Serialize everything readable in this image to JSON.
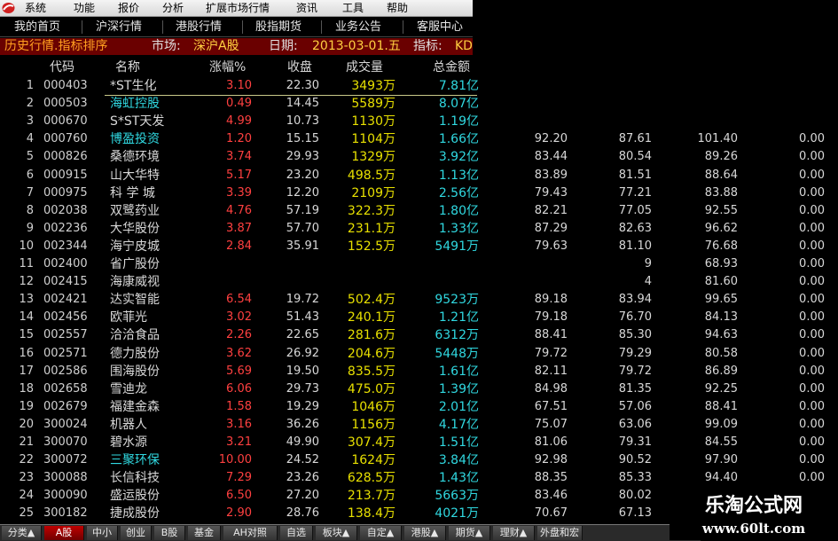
{
  "menu": [
    "系统",
    "功能",
    "报价",
    "分析",
    "扩展市场行情",
    "资讯",
    "工具",
    "帮助"
  ],
  "nav": [
    "我的首页",
    "沪深行情",
    "港股行情",
    "股指期货",
    "业务公告",
    "客服中心"
  ],
  "info": {
    "title": "历史行情.指标排序",
    "market_label": "市场:",
    "market_value": "深沪A股",
    "date_label": "日期:",
    "date_value": "2013-03-01.五",
    "indicator_label": "指标:",
    "indicator_value": "KD"
  },
  "columns": {
    "code": "代码",
    "name": "名称",
    "pct": "涨幅%",
    "close": "收盘",
    "volume": "成交量",
    "amount": "总金额"
  },
  "rows": [
    {
      "idx": "1",
      "code": "000403",
      "name": "*ST生化",
      "pct": "3.10",
      "close": "22.30",
      "vol": "3493万",
      "amt": "7.81亿",
      "e1": "",
      "e2": "",
      "e3": "",
      "e4": "",
      "cyan": false
    },
    {
      "idx": "2",
      "code": "000503",
      "name": "海虹控股",
      "pct": "0.49",
      "close": "14.45",
      "vol": "5589万",
      "amt": "8.07亿",
      "e1": "",
      "e2": "",
      "e3": "",
      "e4": "",
      "cyan": true
    },
    {
      "idx": "3",
      "code": "000670",
      "name": "S*ST天发",
      "pct": "4.99",
      "close": "10.73",
      "vol": "1130万",
      "amt": "1.19亿",
      "e1": "",
      "e2": "",
      "e3": "",
      "e4": "",
      "cyan": false
    },
    {
      "idx": "4",
      "code": "000760",
      "name": "博盈投资",
      "pct": "1.20",
      "close": "15.15",
      "vol": "1104万",
      "amt": "1.66亿",
      "e1": "92.20",
      "e2": "87.61",
      "e3": "101.40",
      "e4": "0.00",
      "cyan": true
    },
    {
      "idx": "5",
      "code": "000826",
      "name": "桑德环境",
      "pct": "3.74",
      "close": "29.93",
      "vol": "1329万",
      "amt": "3.92亿",
      "e1": "83.44",
      "e2": "80.54",
      "e3": "89.26",
      "e4": "0.00",
      "cyan": false
    },
    {
      "idx": "6",
      "code": "000915",
      "name": "山大华特",
      "pct": "5.17",
      "close": "23.20",
      "vol": "498.5万",
      "amt": "1.13亿",
      "e1": "83.89",
      "e2": "81.51",
      "e3": "88.64",
      "e4": "0.00",
      "cyan": false
    },
    {
      "idx": "7",
      "code": "000975",
      "name": "科 学 城",
      "pct": "3.39",
      "close": "12.20",
      "vol": "2109万",
      "amt": "2.56亿",
      "e1": "79.43",
      "e2": "77.21",
      "e3": "83.88",
      "e4": "0.00",
      "cyan": false
    },
    {
      "idx": "8",
      "code": "002038",
      "name": "双鹭药业",
      "pct": "4.76",
      "close": "57.19",
      "vol": "322.3万",
      "amt": "1.80亿",
      "e1": "82.21",
      "e2": "77.05",
      "e3": "92.55",
      "e4": "0.00",
      "cyan": false
    },
    {
      "idx": "9",
      "code": "002236",
      "name": "大华股份",
      "pct": "3.87",
      "close": "57.70",
      "vol": "231.1万",
      "amt": "1.33亿",
      "e1": "87.29",
      "e2": "82.63",
      "e3": "96.62",
      "e4": "0.00",
      "cyan": false
    },
    {
      "idx": "10",
      "code": "002344",
      "name": "海宁皮城",
      "pct": "2.84",
      "close": "35.91",
      "vol": "152.5万",
      "amt": "5491万",
      "e1": "79.63",
      "e2": "81.10",
      "e3": "76.68",
      "e4": "0.00",
      "cyan": false
    },
    {
      "idx": "11",
      "code": "002400",
      "name": "省广股份",
      "pct": "",
      "close": "",
      "vol": "",
      "amt": "",
      "e1": "",
      "e2": "9",
      "e3": "68.93",
      "e4": "0.00",
      "cyan": false
    },
    {
      "idx": "12",
      "code": "002415",
      "name": "海康威视",
      "pct": "",
      "close": "",
      "vol": "",
      "amt": "",
      "e1": "",
      "e2": "4",
      "e3": "81.60",
      "e4": "0.00",
      "cyan": false
    },
    {
      "idx": "13",
      "code": "002421",
      "name": "达实智能",
      "pct": "6.54",
      "close": "19.72",
      "vol": "502.4万",
      "amt": "9523万",
      "e1": "89.18",
      "e2": "83.94",
      "e3": "99.65",
      "e4": "0.00",
      "cyan": false
    },
    {
      "idx": "14",
      "code": "002456",
      "name": "欧菲光",
      "pct": "3.02",
      "close": "51.43",
      "vol": "240.1万",
      "amt": "1.21亿",
      "e1": "79.18",
      "e2": "76.70",
      "e3": "84.13",
      "e4": "0.00",
      "cyan": false
    },
    {
      "idx": "15",
      "code": "002557",
      "name": "洽洽食品",
      "pct": "2.26",
      "close": "22.65",
      "vol": "281.6万",
      "amt": "6312万",
      "e1": "88.41",
      "e2": "85.30",
      "e3": "94.63",
      "e4": "0.00",
      "cyan": false
    },
    {
      "idx": "16",
      "code": "002571",
      "name": "德力股份",
      "pct": "3.62",
      "close": "26.92",
      "vol": "204.6万",
      "amt": "5448万",
      "e1": "79.72",
      "e2": "79.29",
      "e3": "80.58",
      "e4": "0.00",
      "cyan": false
    },
    {
      "idx": "17",
      "code": "002586",
      "name": "围海股份",
      "pct": "5.69",
      "close": "19.50",
      "vol": "835.5万",
      "amt": "1.61亿",
      "e1": "82.11",
      "e2": "79.72",
      "e3": "86.89",
      "e4": "0.00",
      "cyan": false
    },
    {
      "idx": "18",
      "code": "002658",
      "name": "雪迪龙",
      "pct": "6.06",
      "close": "29.73",
      "vol": "475.0万",
      "amt": "1.39亿",
      "e1": "84.98",
      "e2": "81.35",
      "e3": "92.25",
      "e4": "0.00",
      "cyan": false
    },
    {
      "idx": "19",
      "code": "002679",
      "name": "福建金森",
      "pct": "1.58",
      "close": "19.29",
      "vol": "1046万",
      "amt": "2.01亿",
      "e1": "67.51",
      "e2": "57.06",
      "e3": "88.41",
      "e4": "0.00",
      "cyan": false
    },
    {
      "idx": "20",
      "code": "300024",
      "name": "机器人",
      "pct": "3.16",
      "close": "36.26",
      "vol": "1156万",
      "amt": "4.17亿",
      "e1": "75.07",
      "e2": "63.06",
      "e3": "99.09",
      "e4": "0.00",
      "cyan": false
    },
    {
      "idx": "21",
      "code": "300070",
      "name": "碧水源",
      "pct": "3.21",
      "close": "49.90",
      "vol": "307.4万",
      "amt": "1.51亿",
      "e1": "81.06",
      "e2": "79.31",
      "e3": "84.55",
      "e4": "0.00",
      "cyan": false
    },
    {
      "idx": "22",
      "code": "300072",
      "name": "三聚环保",
      "pct": "10.00",
      "close": "24.52",
      "vol": "1624万",
      "amt": "3.84亿",
      "e1": "92.98",
      "e2": "90.52",
      "e3": "97.90",
      "e4": "0.00",
      "cyan": true
    },
    {
      "idx": "23",
      "code": "300088",
      "name": "长信科技",
      "pct": "7.29",
      "close": "23.26",
      "vol": "628.5万",
      "amt": "1.43亿",
      "e1": "88.35",
      "e2": "85.33",
      "e3": "94.40",
      "e4": "0.00",
      "cyan": false
    },
    {
      "idx": "24",
      "code": "300090",
      "name": "盛运股份",
      "pct": "6.50",
      "close": "27.20",
      "vol": "213.7万",
      "amt": "5663万",
      "e1": "83.46",
      "e2": "80.02",
      "e3": "",
      "e4": "",
      "cyan": false
    },
    {
      "idx": "25",
      "code": "300182",
      "name": "捷成股份",
      "pct": "2.90",
      "close": "28.76",
      "vol": "138.4万",
      "amt": "4021万",
      "e1": "70.67",
      "e2": "67.13",
      "e3": "",
      "e4": "",
      "cyan": false
    }
  ],
  "tabs": [
    {
      "label": "分类▲",
      "active": false
    },
    {
      "label": "A股",
      "active": true
    },
    {
      "label": "中小",
      "active": false
    },
    {
      "label": "创业",
      "active": false
    },
    {
      "label": "B股",
      "active": false
    },
    {
      "label": "基金",
      "active": false
    },
    {
      "label": "AH对照",
      "active": false
    },
    {
      "label": "自选",
      "active": false
    },
    {
      "label": "板块▲",
      "active": false
    },
    {
      "label": "自定▲",
      "active": false
    },
    {
      "label": "港股▲",
      "active": false
    },
    {
      "label": "期货▲",
      "active": false
    },
    {
      "label": "理财▲",
      "active": false
    },
    {
      "label": "外盘和宏",
      "active": false
    }
  ],
  "watermark": {
    "title": "乐淘公式网",
    "url": "www.60lt.com"
  },
  "colors": {
    "up": "#ff4040",
    "volume": "#e8e000",
    "amount": "#30d8e0",
    "infobar": "#6a0000",
    "active_tab": "#c00000"
  }
}
